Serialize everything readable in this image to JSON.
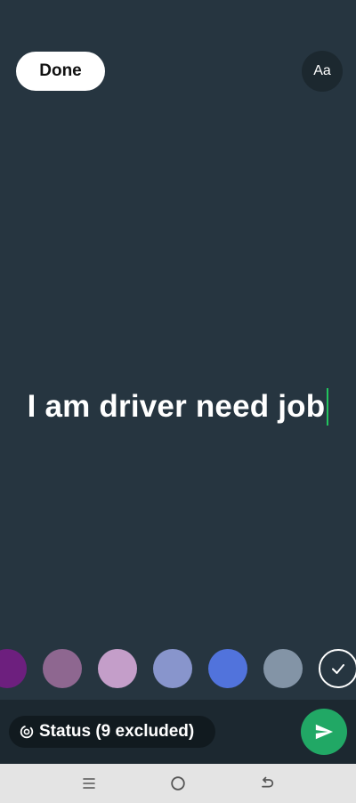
{
  "toolbar": {
    "done_label": "Done",
    "font_label": "Aa"
  },
  "editor": {
    "text": "I am driver need job"
  },
  "palette": {
    "colors": [
      "#6d1f7e",
      "#8e6790",
      "#c49ec9",
      "#8895cc",
      "#5173dc",
      "#8394a6"
    ],
    "selected_is_check": true
  },
  "audience": {
    "label": "Status (9 excluded)"
  },
  "icons": {
    "done": "done-button",
    "font": "font-style-icon",
    "audience": "status-privacy-icon",
    "send": "send-icon",
    "check": "check-icon",
    "nav_recent": "recent-apps-icon",
    "nav_home": "home-icon",
    "nav_back": "back-icon"
  },
  "colors": {
    "background": "#263540",
    "accent": "#21a865",
    "caret": "#22c55e"
  }
}
